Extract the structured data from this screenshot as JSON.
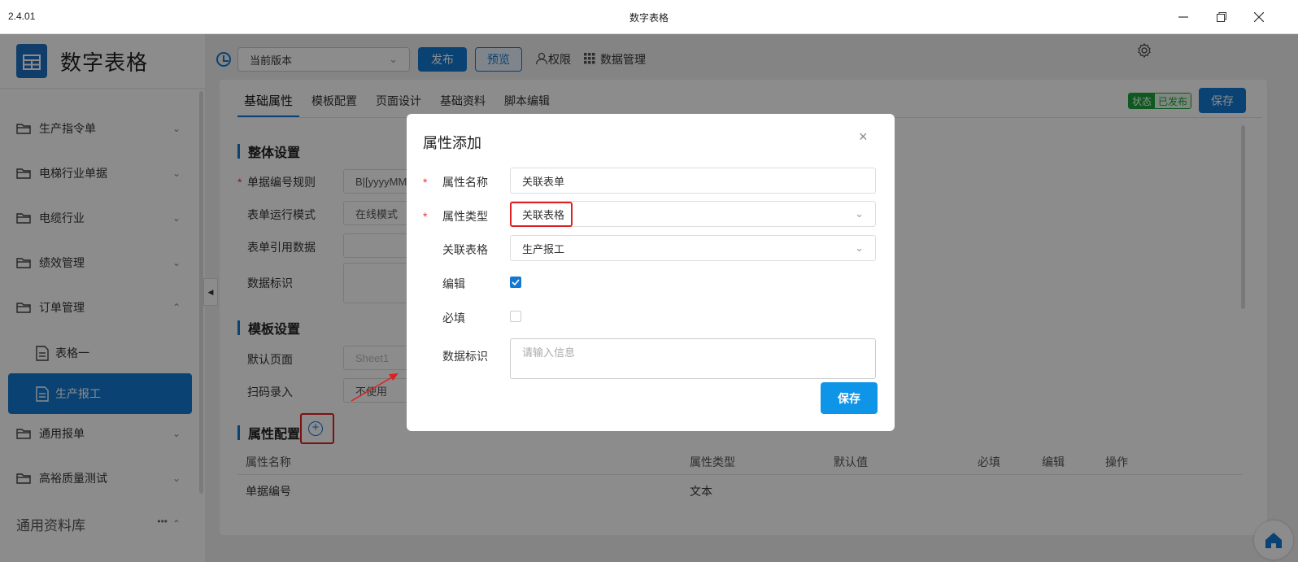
{
  "window": {
    "version": "2.4.01",
    "title": "数字表格"
  },
  "sidebar": {
    "app_title": "数字表格",
    "items": [
      {
        "label": "生产指令单"
      },
      {
        "label": "电梯行业单据"
      },
      {
        "label": "电缆行业"
      },
      {
        "label": "绩效管理"
      },
      {
        "label": "订单管理"
      },
      {
        "label": "通用报单"
      },
      {
        "label": "高裕质量测试"
      }
    ],
    "sub_items": [
      {
        "label": "表格一"
      },
      {
        "label": "生产报工",
        "active": true
      }
    ],
    "library": {
      "label": "通用资料库",
      "more": "•••"
    }
  },
  "toolbar": {
    "version_select": "当前版本",
    "publish": "发布",
    "preview": "预览",
    "permission": "权限",
    "data_manage": "数据管理"
  },
  "tabs": [
    "基础属性",
    "模板配置",
    "页面设计",
    "基础资料",
    "脚本编辑"
  ],
  "status": {
    "key": "状态",
    "value": "已发布"
  },
  "save_label": "保存",
  "form": {
    "section_overall": "整体设置",
    "code_rule": {
      "label": "单据编号规则",
      "value": "B|[yyyyMM"
    },
    "run_mode": {
      "label": "表单运行模式",
      "value": "在线模式"
    },
    "ref_data": {
      "label": "表单引用数据",
      "value": ""
    },
    "data_flag": {
      "label": "数据标识",
      "value": ""
    },
    "section_template": "模板设置",
    "default_page": {
      "label": "默认页面",
      "value": "Sheet1"
    },
    "scan_input": {
      "label": "扫码录入",
      "value": "不使用"
    },
    "section_attr": "属性配置"
  },
  "table": {
    "headers": [
      "属性名称",
      "属性类型",
      "默认值",
      "必填",
      "编辑",
      "操作"
    ],
    "rows": [
      {
        "name": "单据编号",
        "type": "文本"
      }
    ]
  },
  "modal": {
    "title": "属性添加",
    "close": "×",
    "attr_name": {
      "label": "属性名称",
      "value": "关联表单"
    },
    "attr_type": {
      "label": "属性类型",
      "value": "关联表格"
    },
    "related_table": {
      "label": "关联表格",
      "value": "生产报工"
    },
    "edit": {
      "label": "编辑",
      "checked": true
    },
    "required": {
      "label": "必填",
      "checked": false
    },
    "data_flag": {
      "label": "数据标识",
      "placeholder": "请输入信息"
    },
    "save": "保存"
  },
  "colors": {
    "accent": "#1278d1",
    "status_green": "#19a33a",
    "highlight_red": "#e02020"
  }
}
